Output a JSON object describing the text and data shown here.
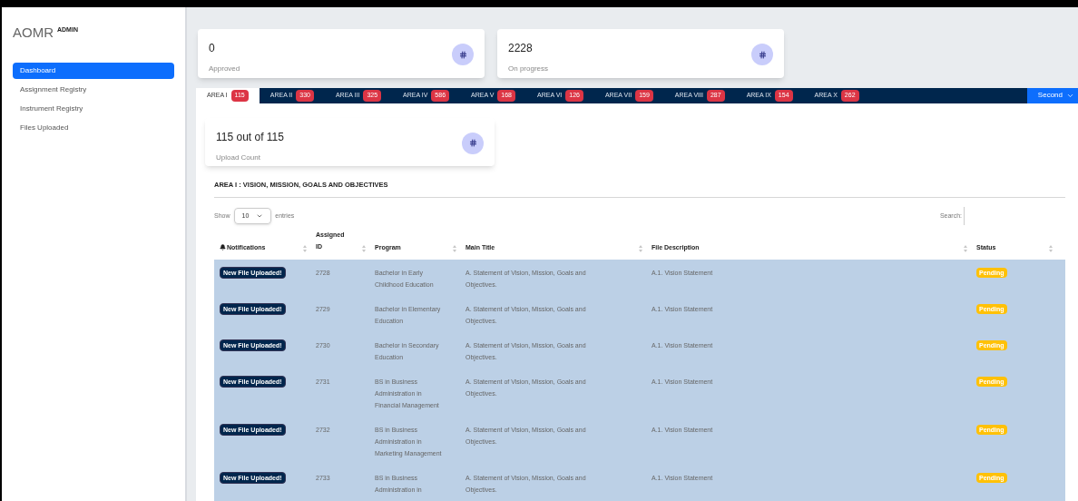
{
  "sidebar": {
    "logo": "AOMR",
    "role": "ADMIN",
    "items": [
      {
        "label": "Dashboard",
        "selected": true
      },
      {
        "label": "Assignment Registry",
        "selected": false
      },
      {
        "label": "Instrument Registry",
        "selected": false
      },
      {
        "label": "Files Uploaded",
        "selected": false
      }
    ]
  },
  "stat_cards": [
    {
      "value": "0",
      "label": "Approved"
    },
    {
      "value": "2228",
      "label": "On progress"
    }
  ],
  "tabs": [
    {
      "label": "AREA I",
      "count": "115",
      "selected": true
    },
    {
      "label": "AREA II",
      "count": "330",
      "selected": false
    },
    {
      "label": "AREA III",
      "count": "325",
      "selected": false
    },
    {
      "label": "AREA IV",
      "count": "586",
      "selected": false
    },
    {
      "label": "AREA V",
      "count": "168",
      "selected": false
    },
    {
      "label": "AREA VI",
      "count": "126",
      "selected": false
    },
    {
      "label": "AREA VII",
      "count": "159",
      "selected": false
    },
    {
      "label": "AREA VIII",
      "count": "287",
      "selected": false
    },
    {
      "label": "AREA IX",
      "count": "154",
      "selected": false
    },
    {
      "label": "AREA X",
      "count": "262",
      "selected": false
    }
  ],
  "semester_dropdown": "Second",
  "upload_card": {
    "value": "115 out of 115",
    "label": "Upload Count"
  },
  "section_title": "AREA I : VISION, MISSION, GOALS AND OBJECTIVES",
  "entries": {
    "before": "Show",
    "value": "10",
    "after": "entries"
  },
  "search": {
    "label": "Search:"
  },
  "table": {
    "columns": [
      "Notifications",
      "Assigned ID",
      "Program",
      "Main Title",
      "File Description",
      "Status"
    ],
    "rows": [
      {
        "notification": "New File Uploaded!",
        "id": "2728",
        "program": "Bachelor in Early Childhood Education",
        "title": "A. Statement of Vision, Mission, Goals and Objectives.",
        "description": "A.1. Vision Statement",
        "status": "Pending"
      },
      {
        "notification": "New File Uploaded!",
        "id": "2729",
        "program": "Bachelor in Elementary Education",
        "title": "A. Statement of Vision, Mission, Goals and Objectives.",
        "description": "A.1. Vision Statement",
        "status": "Pending"
      },
      {
        "notification": "New File Uploaded!",
        "id": "2730",
        "program": "Bachelor in Secondary Education",
        "title": "A. Statement of Vision, Mission, Goals and Objectives.",
        "description": "A.1. Vision Statement",
        "status": "Pending"
      },
      {
        "notification": "New File Uploaded!",
        "id": "2731",
        "program": "BS in Business Administration in Financial Management",
        "title": "A. Statement of Vision, Mission, Goals and Objectives.",
        "description": "A.1. Vision Statement",
        "status": "Pending"
      },
      {
        "notification": "New File Uploaded!",
        "id": "2732",
        "program": "BS in Business Administration in Marketing Management",
        "title": "A. Statement of Vision, Mission, Goals and Objectives.",
        "description": "A.1. Vision Statement",
        "status": "Pending"
      },
      {
        "notification": "New File Uploaded!",
        "id": "2733",
        "program": "BS in Business Administration in",
        "title": "A. Statement of Vision, Mission, Goals and Objectives.",
        "description": "A.1. Vision Statement",
        "status": "Pending"
      }
    ]
  }
}
